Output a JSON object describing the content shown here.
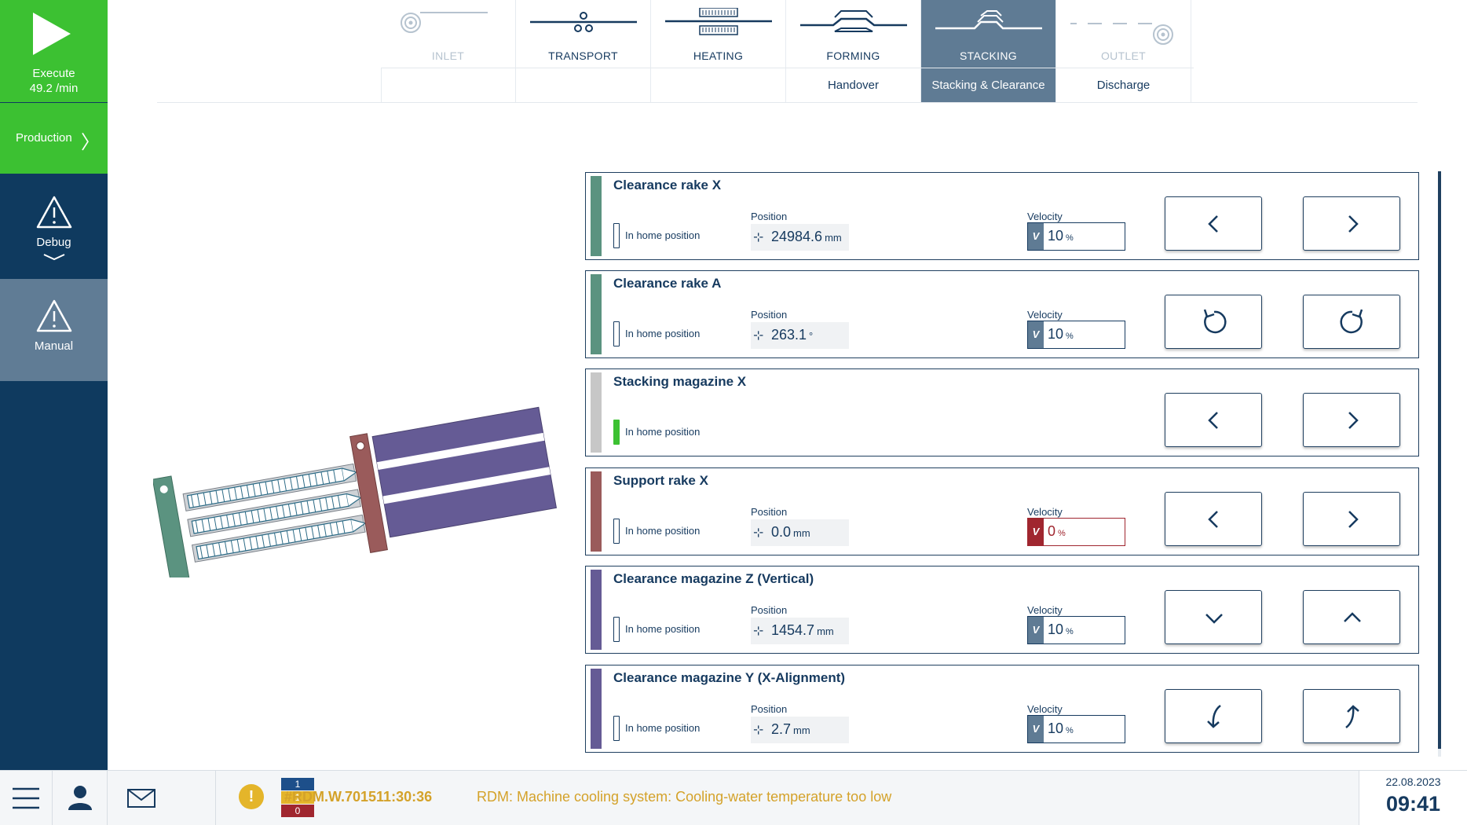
{
  "sidebar": {
    "execute": {
      "label": "Execute",
      "rate": "49.2 /min"
    },
    "production": {
      "label": "Production",
      "chevron": "〉"
    },
    "debug": {
      "label": "Debug"
    },
    "manual": {
      "label": "Manual"
    }
  },
  "steps": [
    {
      "label": "INLET",
      "state": "disabled",
      "icon": "coil-inlet-icon"
    },
    {
      "label": "TRANSPORT",
      "state": "normal",
      "icon": "transport-icon"
    },
    {
      "label": "HEATING",
      "state": "normal",
      "icon": "heating-icon"
    },
    {
      "label": "FORMING",
      "state": "normal",
      "icon": "forming-icon"
    },
    {
      "label": "STACKING",
      "state": "active",
      "icon": "stacking-icon"
    },
    {
      "label": "OUTLET",
      "state": "disabled",
      "icon": "coil-outlet-icon"
    }
  ],
  "substeps": [
    {
      "label": "Handover",
      "state": "normal"
    },
    {
      "label": "Stacking & Clearance",
      "state": "active"
    },
    {
      "label": "Discharge",
      "state": "normal"
    }
  ],
  "labels": {
    "home": "In home position",
    "position": "Position",
    "velocity": "Velocity",
    "vel_prefix": "V",
    "pos_icon": "⊹"
  },
  "axes": [
    {
      "title": "Clearance rake X",
      "color": "#5b9380",
      "home": false,
      "position": "24984.6",
      "pos_unit": "mm",
      "velocity": "10",
      "vel_unit": "%",
      "vel_alert": false,
      "buttons": [
        "chevron-left-icon",
        "chevron-right-icon"
      ]
    },
    {
      "title": "Clearance rake A",
      "color": "#5b9380",
      "home": false,
      "position": "263.1",
      "pos_unit": "°",
      "velocity": "10",
      "vel_unit": "%",
      "vel_alert": false,
      "buttons": [
        "rotate-ccw-icon",
        "rotate-cw-icon"
      ]
    },
    {
      "title": "Stacking magazine X",
      "color": "#c7c7c7",
      "home": true,
      "position": null,
      "pos_unit": null,
      "velocity": null,
      "vel_unit": null,
      "vel_alert": false,
      "buttons": [
        "chevron-left-icon",
        "chevron-right-icon"
      ]
    },
    {
      "title": "Support rake X",
      "color": "#9a5b5b",
      "home": false,
      "position": "0.0",
      "pos_unit": "mm",
      "velocity": "0",
      "vel_unit": "%",
      "vel_alert": true,
      "buttons": [
        "chevron-left-icon",
        "chevron-right-icon"
      ]
    },
    {
      "title": "Clearance magazine Z (Vertical)",
      "color": "#655b95",
      "home": false,
      "position": "1454.7",
      "pos_unit": "mm",
      "velocity": "10",
      "vel_unit": "%",
      "vel_alert": false,
      "buttons": [
        "chevron-down-icon",
        "chevron-up-icon"
      ]
    },
    {
      "title": "Clearance magazine Y (X-Alignment)",
      "color": "#655b95",
      "home": false,
      "position": "2.7",
      "pos_unit": "mm",
      "velocity": "10",
      "vel_unit": "%",
      "vel_alert": false,
      "buttons": [
        "curve-down-arrow-icon",
        "curve-up-arrow-icon"
      ]
    }
  ],
  "footer": {
    "counters": [
      {
        "value": "1",
        "color": "#1d4f8a"
      },
      {
        "value": "1",
        "color": "#e4b52a"
      },
      {
        "value": "0",
        "color": "#a0262f"
      }
    ],
    "warning_symbol": "!",
    "alarm_code": "#RDM.W.701511:30:36",
    "alarm_message": "RDM: Machine cooling system: Cooling-water temperature too low",
    "date": "22.08.2023",
    "time": "09:41"
  }
}
